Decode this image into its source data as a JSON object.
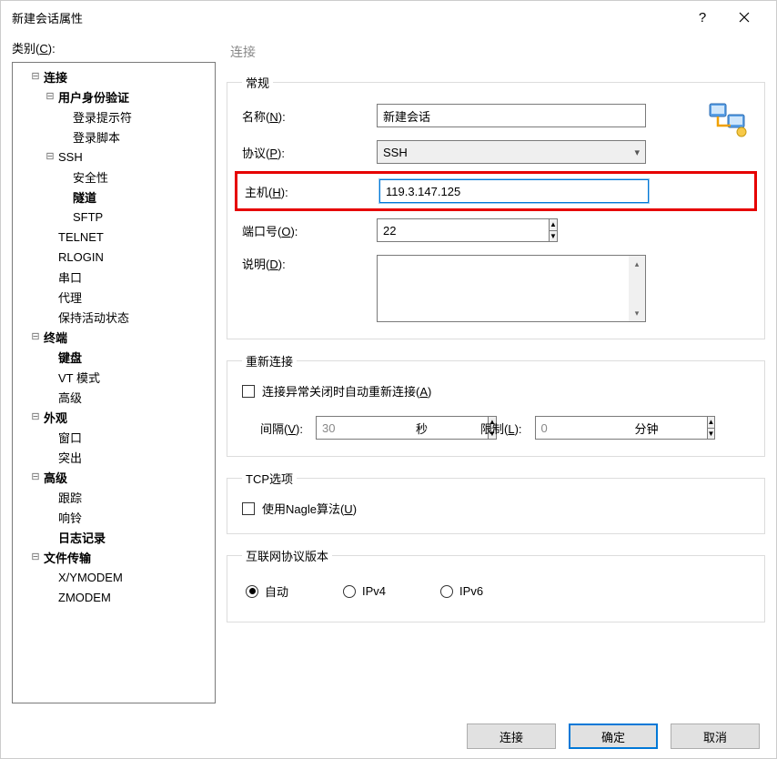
{
  "titlebar": {
    "title": "新建会话属性"
  },
  "left": {
    "category_label_pre": "类别(",
    "category_label_key": "C",
    "category_label_post": "):",
    "tree": [
      {
        "level": 1,
        "expand": "⊟",
        "bold": true,
        "label": "连接"
      },
      {
        "level": 2,
        "expand": "⊟",
        "bold": true,
        "label": "用户身份验证"
      },
      {
        "level": 3,
        "expand": "",
        "bold": false,
        "label": "登录提示符"
      },
      {
        "level": 3,
        "expand": "",
        "bold": false,
        "label": "登录脚本"
      },
      {
        "level": 2,
        "expand": "⊟",
        "bold": false,
        "label": "SSH"
      },
      {
        "level": 3,
        "expand": "",
        "bold": false,
        "label": "安全性"
      },
      {
        "level": 3,
        "expand": "",
        "bold": true,
        "label": "隧道"
      },
      {
        "level": 3,
        "expand": "",
        "bold": false,
        "label": "SFTP"
      },
      {
        "level": 2,
        "expand": "",
        "bold": false,
        "label": "TELNET"
      },
      {
        "level": 2,
        "expand": "",
        "bold": false,
        "label": "RLOGIN"
      },
      {
        "level": 2,
        "expand": "",
        "bold": false,
        "label": "串口"
      },
      {
        "level": 2,
        "expand": "",
        "bold": false,
        "label": "代理"
      },
      {
        "level": 2,
        "expand": "",
        "bold": false,
        "label": "保持活动状态"
      },
      {
        "level": 1,
        "expand": "⊟",
        "bold": true,
        "label": "终端"
      },
      {
        "level": 2,
        "expand": "",
        "bold": true,
        "label": "键盘"
      },
      {
        "level": 2,
        "expand": "",
        "bold": false,
        "label": "VT 模式"
      },
      {
        "level": 2,
        "expand": "",
        "bold": false,
        "label": "高级"
      },
      {
        "level": 1,
        "expand": "⊟",
        "bold": true,
        "label": "外观"
      },
      {
        "level": 2,
        "expand": "",
        "bold": false,
        "label": "窗口"
      },
      {
        "level": 2,
        "expand": "",
        "bold": false,
        "label": "突出"
      },
      {
        "level": 1,
        "expand": "⊟",
        "bold": true,
        "label": "高级"
      },
      {
        "level": 2,
        "expand": "",
        "bold": false,
        "label": "跟踪"
      },
      {
        "level": 2,
        "expand": "",
        "bold": false,
        "label": "响铃"
      },
      {
        "level": 2,
        "expand": "",
        "bold": true,
        "label": "日志记录"
      },
      {
        "level": 1,
        "expand": "⊟",
        "bold": true,
        "label": "文件传输"
      },
      {
        "level": 2,
        "expand": "",
        "bold": false,
        "label": "X/YMODEM"
      },
      {
        "level": 2,
        "expand": "",
        "bold": false,
        "label": "ZMODEM"
      }
    ]
  },
  "right": {
    "panel_title": "连接",
    "general": {
      "legend": "常规",
      "name_label": "名称(<u>N</u>):",
      "name_value": "新建会话",
      "protocol_label": "协议(<u>P</u>):",
      "protocol_value": "SSH",
      "host_label": "主机(<u>H</u>):",
      "host_value": "119.3.147.125",
      "port_label": "端口号(<u>O</u>):",
      "port_value": "22",
      "desc_label": "说明(<u>D</u>):"
    },
    "reconnect": {
      "legend": "重新连接",
      "chk_label": "连接异常关闭时自动重新连接(<u>A</u>)",
      "interval_label": "间隔(<u>V</u>):",
      "interval_value": "30",
      "interval_unit": "秒",
      "limit_label": "限制(<u>L</u>):",
      "limit_value": "0",
      "limit_unit": "分钟"
    },
    "tcp": {
      "legend": "TCP选项",
      "nagle_label": "使用Nagle算法(<u>U</u>)"
    },
    "ipver": {
      "legend": "互联网协议版本",
      "auto": "自动",
      "ipv4": "IPv4",
      "ipv6": "IPv6",
      "selected": "auto"
    }
  },
  "footer": {
    "connect": "连接",
    "ok": "确定",
    "cancel": "取消"
  }
}
